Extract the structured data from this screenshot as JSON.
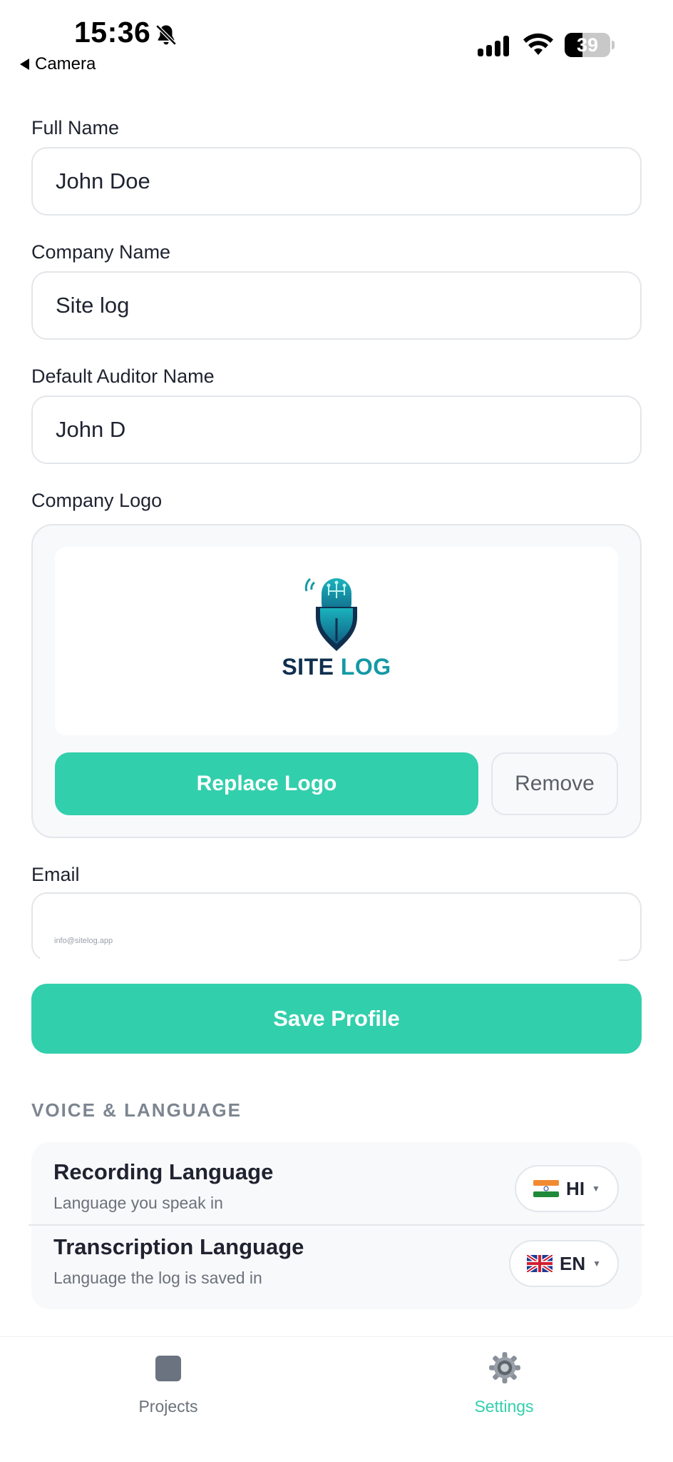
{
  "status_bar": {
    "time": "15:36",
    "back_label": "Camera",
    "battery_level": "39",
    "battery_fraction": 0.39
  },
  "form": {
    "full_name": {
      "label": "Full Name",
      "value": "John Doe"
    },
    "company_name": {
      "label": "Company Name",
      "value": "Site log"
    },
    "auditor_name": {
      "label": "Default Auditor Name",
      "value": "John D"
    },
    "logo": {
      "label": "Company Logo",
      "logo_text_part1": "SITE",
      "logo_text_part2": "LOG",
      "replace_label": "Replace Logo",
      "remove_label": "Remove"
    },
    "email": {
      "label": "Email",
      "value": "info@sitelog.app"
    },
    "save_label": "Save Profile"
  },
  "voice_language": {
    "section_title": "VOICE & LANGUAGE",
    "recording": {
      "title": "Recording Language",
      "subtitle": "Language you speak in",
      "code": "HI",
      "flag": "india-flag-icon"
    },
    "transcription": {
      "title": "Transcription Language",
      "subtitle": "Language the log is saved in",
      "code": "EN",
      "flag": "uk-flag-icon"
    }
  },
  "tab_bar": {
    "projects_label": "Projects",
    "settings_label": "Settings",
    "active": "settings"
  },
  "colors": {
    "accent": "#32cfac",
    "border": "#e3e6ea",
    "text": "#1f2330",
    "muted": "#6b727b"
  }
}
